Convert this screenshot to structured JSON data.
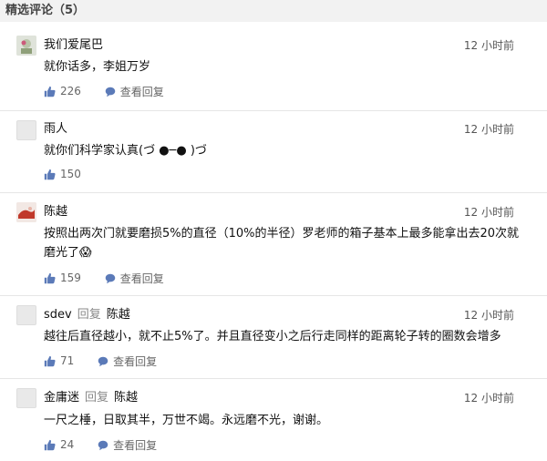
{
  "section": {
    "title": "精选评论（5）"
  },
  "icons": {
    "like": "thumbs-up-icon",
    "reply": "speech-bubble-icon"
  },
  "comments": [
    {
      "user": "我们爱尾巴",
      "time": "12 小时前",
      "text": "就你话多，李姐万岁",
      "likes": "226",
      "view_replies": "查看回复"
    },
    {
      "user": "雨人",
      "time": "12 小时前",
      "text": "就你们科学家认真(づ ●─● )づ",
      "likes": "150"
    },
    {
      "user": "陈越",
      "time": "12 小时前",
      "text": "按照出两次门就要磨损5%的直径（10%的半径）罗老师的箱子基本上最多能拿出去20次就磨光了😱",
      "likes": "159",
      "view_replies": "查看回复"
    },
    {
      "user": "sdev",
      "reply_word": "回复",
      "reply_to": "陈越",
      "time": "12 小时前",
      "text": "越往后直径越小，就不止5%了。并且直径变小之后行走同样的距离轮子转的圈数会增多",
      "likes": "71",
      "view_replies": "查看回复"
    },
    {
      "user": "金庸迷",
      "reply_word": "回复",
      "reply_to": "陈越",
      "time": "12 小时前",
      "text": "一尺之棰，日取其半，万世不竭。永远磨不光，谢谢。",
      "likes": "24",
      "view_replies": "查看回复"
    }
  ]
}
